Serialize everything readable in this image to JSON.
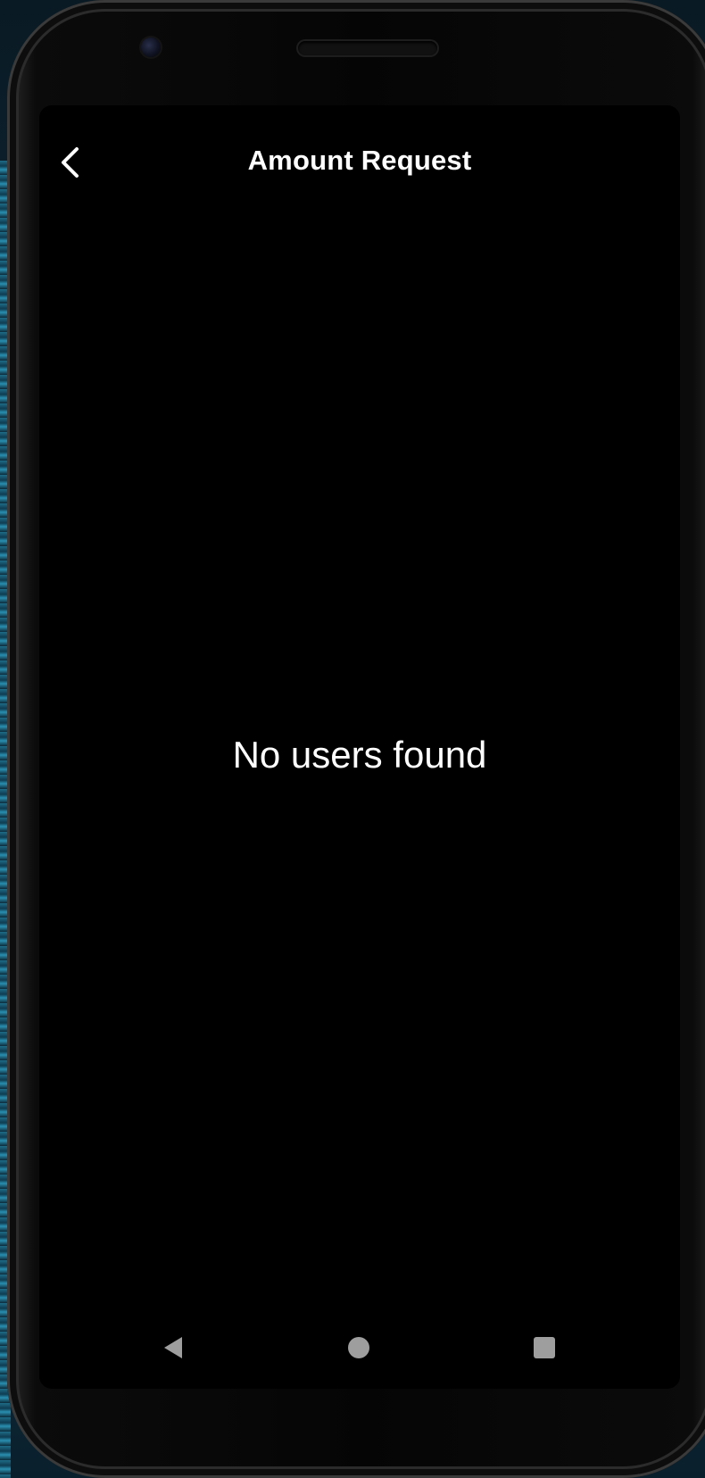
{
  "header": {
    "title": "Amount Request",
    "back_icon": "chevron-left-icon"
  },
  "main": {
    "empty_message": "No users found"
  },
  "system_nav": {
    "back_icon": "triangle-back-icon",
    "home_icon": "circle-home-icon",
    "recents_icon": "square-recents-icon"
  },
  "colors": {
    "background": "#000000",
    "text": "#ffffff",
    "nav_icon": "#9e9e9e"
  }
}
